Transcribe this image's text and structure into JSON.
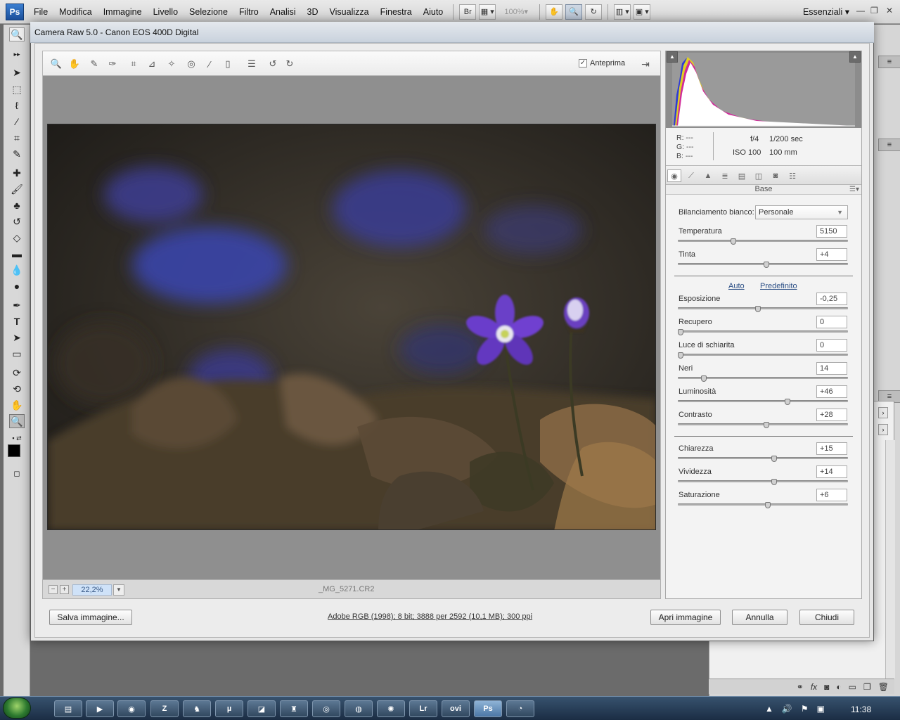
{
  "photoshop": {
    "logo": "Ps",
    "menus": [
      "File",
      "Modifica",
      "Immagine",
      "Livello",
      "Selezione",
      "Filtro",
      "Analisi",
      "3D",
      "Visualizza",
      "Finestra",
      "Aiuto"
    ],
    "bridge_label": "Br",
    "zoom_level": "100%",
    "workspace": "Essenziali"
  },
  "camera_raw": {
    "title": "Camera Raw 5.0  -  Canon EOS 400D Digital",
    "preview_label": "Anteprima",
    "zoom": "22,2%",
    "filename": "_MG_5271.CR2",
    "readout": {
      "r": "R:  ---",
      "g": "G:  ---",
      "b": "B:  ---",
      "aperture": "f/4",
      "shutter": "1/200 sec",
      "iso": "ISO 100",
      "focal": "100 mm"
    },
    "panel_name": "Base",
    "white_balance_label": "Bilanciamento bianco:",
    "white_balance_value": "Personale",
    "auto_link": "Auto",
    "default_link": "Predefinito",
    "sliders": [
      {
        "label": "Temperatura",
        "value": "5150",
        "pos": 0.32
      },
      {
        "label": "Tinta",
        "value": "+4",
        "pos": 0.52
      },
      {
        "label": "Esposizione",
        "value": "-0,25",
        "pos": 0.47
      },
      {
        "label": "Recupero",
        "value": "0",
        "pos": 0.0
      },
      {
        "label": "Luce di schiarita",
        "value": "0",
        "pos": 0.0
      },
      {
        "label": "Neri",
        "value": "14",
        "pos": 0.14
      },
      {
        "label": "Luminosità",
        "value": "+46",
        "pos": 0.65
      },
      {
        "label": "Contrasto",
        "value": "+28",
        "pos": 0.52
      },
      {
        "label": "Chiarezza",
        "value": "+15",
        "pos": 0.57
      },
      {
        "label": "Vividezza",
        "value": "+14",
        "pos": 0.57
      },
      {
        "label": "Saturazione",
        "value": "+6",
        "pos": 0.53
      }
    ],
    "save_button": "Salva immagine...",
    "workflow_link": "Adobe RGB (1998); 8 bit; 3888 per 2592 (10,1 MB); 300 ppi",
    "open_button": "Apri immagine",
    "cancel_button": "Annulla",
    "close_button": "Chiudi"
  },
  "taskbar": {
    "clock": "11:38",
    "lr_label": "Lr",
    "ovi_label": "ovi",
    "ps_label": "Ps"
  },
  "colors": {
    "accent": "#2c4f86",
    "zoom_bg": "#cfe2f8",
    "dialog_bg": "#ececec"
  }
}
